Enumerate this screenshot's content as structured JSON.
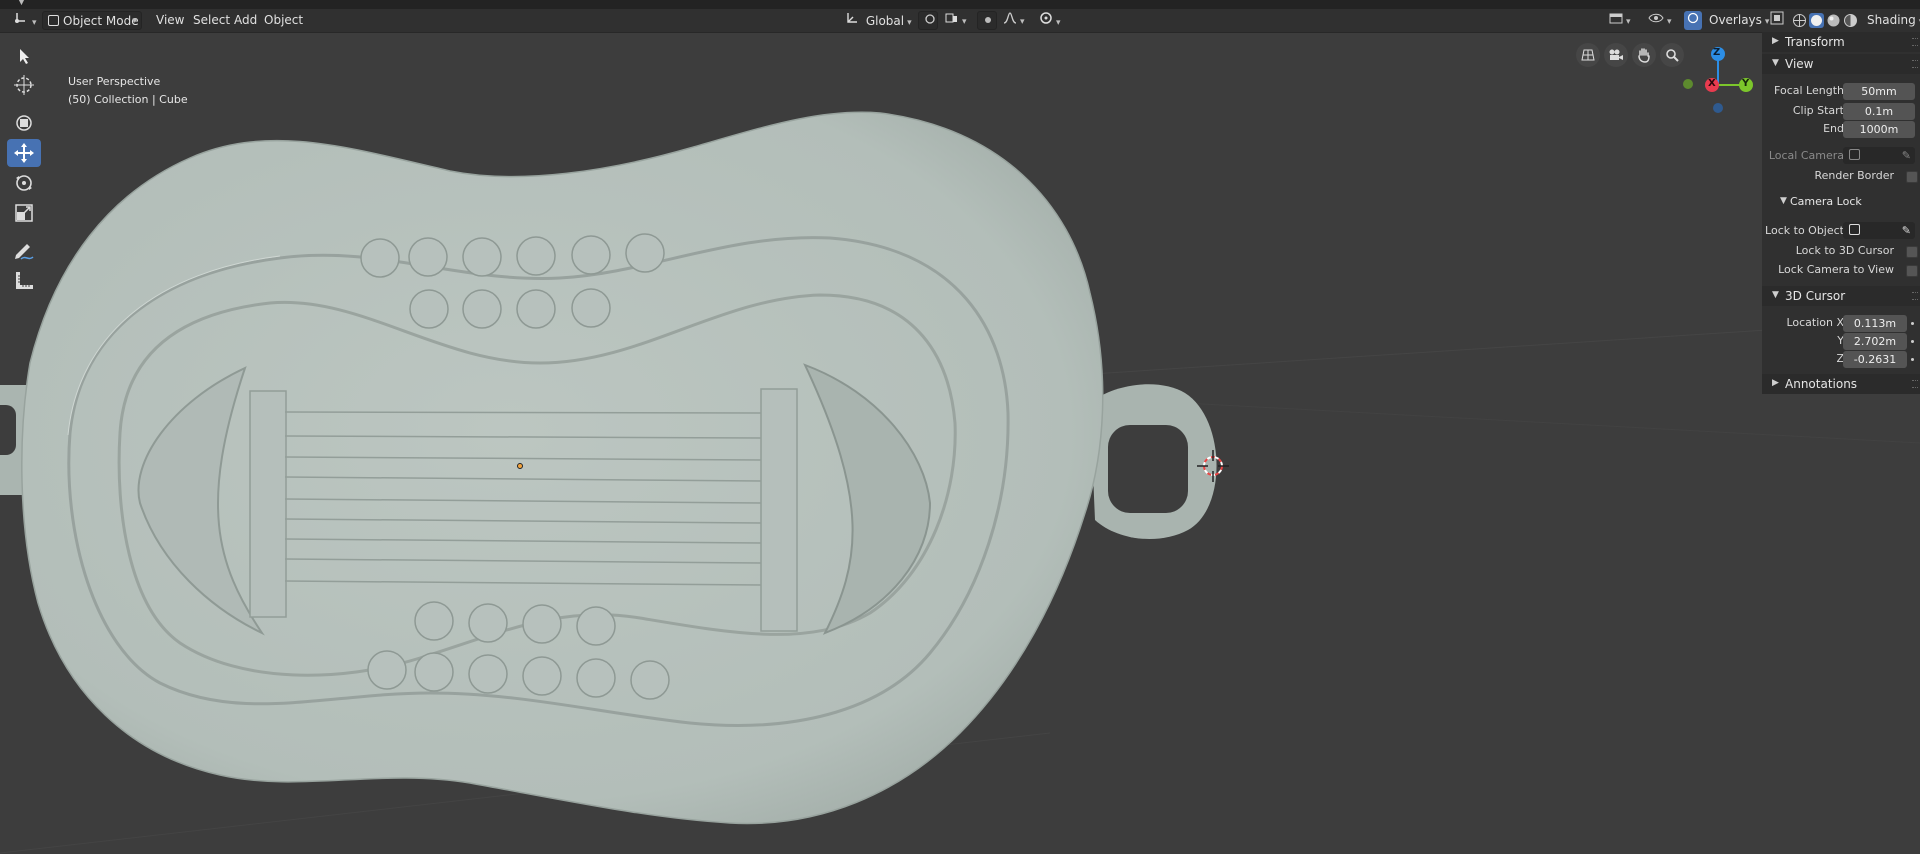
{
  "header": {
    "mode": "Object Mode",
    "menus": [
      "View",
      "Select",
      "Add",
      "Object"
    ],
    "orientation": "Global",
    "overlays_label": "Overlays",
    "shading_label": "Shading"
  },
  "viewport": {
    "perspective": "User Perspective",
    "collection": "(50) Collection | Cube"
  },
  "gizmo": {
    "x": "X",
    "y": "Y",
    "z": "Z"
  },
  "toolbar": {
    "tools": [
      "select-box-tool",
      "cursor-tool",
      "move-tool",
      "transform-tool",
      "rotate-tool",
      "scale-tool",
      "annotate-tool",
      "measure-tool"
    ],
    "active": "move-tool"
  },
  "npanel": {
    "transform": "Transform",
    "view": "View",
    "focal_length_label": "Focal Length",
    "focal_length": "50mm",
    "clip_start_label": "Clip Start",
    "clip_start": "0.1m",
    "clip_end_label": "End",
    "clip_end": "1000m",
    "local_camera_label": "Local Camera",
    "render_border_label": "Render Border",
    "camera_lock": "Camera Lock",
    "lock_to_object_label": "Lock to Object",
    "lock_to_3d_cursor_label": "Lock to 3D Cursor",
    "lock_camera_to_view_label": "Lock Camera to View",
    "cursor_section": "3D Cursor",
    "location_x_label": "Location X",
    "location_x": "0.113m",
    "location_y_label": "Y",
    "location_y": "2.702m",
    "location_z_label": "Z",
    "location_z": "-0.2631",
    "annotations": "Annotations"
  },
  "colors": {
    "background": "#3d3d3d",
    "model": "#b8c2bd",
    "accent": "#4772b3",
    "axis_x": "#e83b4f",
    "axis_y": "#7cc62b",
    "axis_z": "#2c8ee6"
  }
}
